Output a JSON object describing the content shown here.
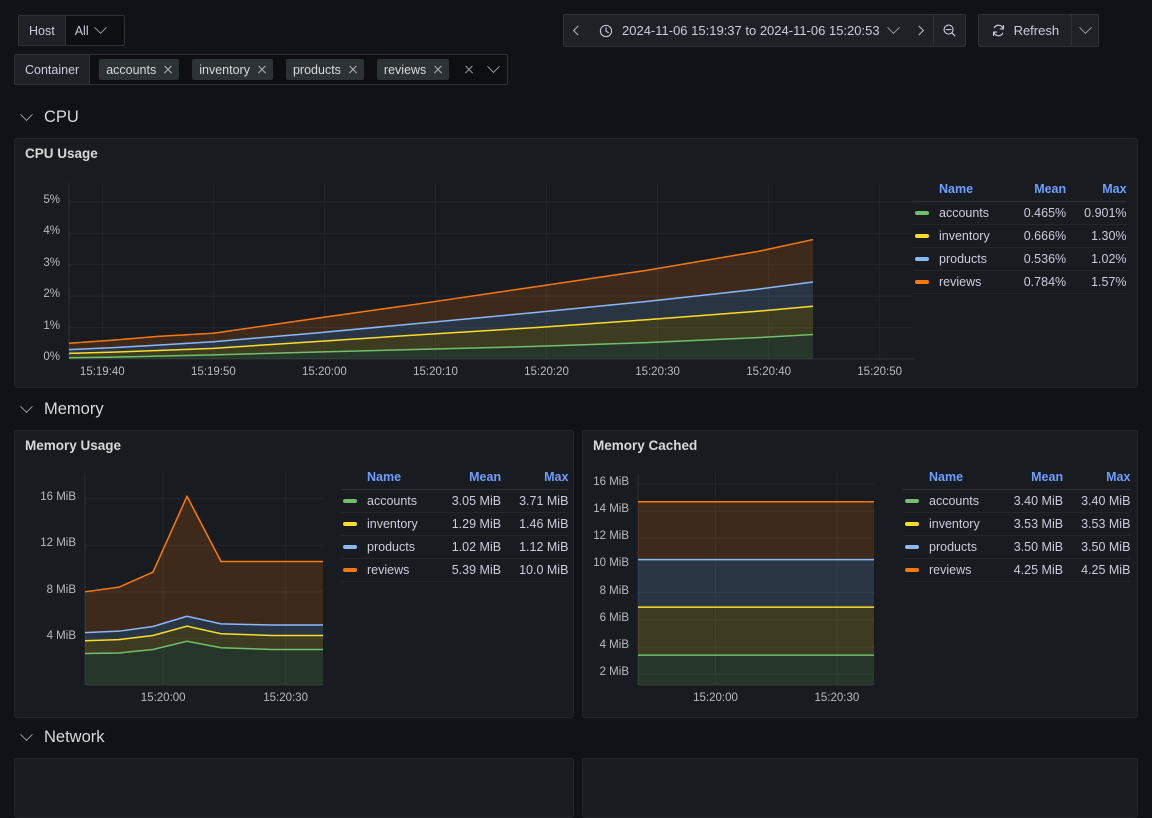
{
  "variables": {
    "host": {
      "label": "Host",
      "value": "All"
    },
    "container": {
      "label": "Container",
      "values": [
        "accounts",
        "inventory",
        "products",
        "reviews"
      ]
    }
  },
  "timepicker": {
    "range": "2024-11-06 15:19:37 to 2024-11-06 15:20:53",
    "prev_icon": "chevron-left-icon",
    "next_icon": "chevron-right-icon",
    "clock_icon": "clock-icon",
    "zoom_out_icon": "zoom-out-icon",
    "refresh_label": "Refresh",
    "refresh_icon": "refresh-icon"
  },
  "rows": [
    {
      "title": "CPU"
    },
    {
      "title": "Memory"
    },
    {
      "title": "Network"
    }
  ],
  "legend_headers": {
    "name": "Name",
    "mean": "Mean",
    "max": "Max"
  },
  "colors": {
    "accounts": "#73BF69",
    "inventory": "#FADE2A",
    "products": "#8AB8FF",
    "reviews": "#FF780A",
    "panel_bg": "#181b1f",
    "page_bg": "#111217",
    "accent": "#6e9fff"
  },
  "panels": {
    "cpu_usage": {
      "title": "CPU Usage",
      "legend": [
        {
          "name": "accounts",
          "mean": "0.465%",
          "max": "0.901%",
          "color": "#73BF69"
        },
        {
          "name": "inventory",
          "mean": "0.666%",
          "max": "1.30%",
          "color": "#FADE2A"
        },
        {
          "name": "products",
          "mean": "0.536%",
          "max": "1.02%",
          "color": "#8AB8FF"
        },
        {
          "name": "reviews",
          "mean": "0.784%",
          "max": "1.57%",
          "color": "#FF780A"
        }
      ]
    },
    "memory_usage": {
      "title": "Memory Usage",
      "legend": [
        {
          "name": "accounts",
          "mean": "3.05 MiB",
          "max": "3.71 MiB",
          "color": "#73BF69"
        },
        {
          "name": "inventory",
          "mean": "1.29 MiB",
          "max": "1.46 MiB",
          "color": "#FADE2A"
        },
        {
          "name": "products",
          "mean": "1.02 MiB",
          "max": "1.12 MiB",
          "color": "#8AB8FF"
        },
        {
          "name": "reviews",
          "mean": "5.39 MiB",
          "max": "10.0 MiB",
          "color": "#FF780A"
        }
      ]
    },
    "memory_cached": {
      "title": "Memory Cached",
      "legend": [
        {
          "name": "accounts",
          "mean": "3.40 MiB",
          "max": "3.40 MiB",
          "color": "#73BF69"
        },
        {
          "name": "inventory",
          "mean": "3.53 MiB",
          "max": "3.53 MiB",
          "color": "#FADE2A"
        },
        {
          "name": "products",
          "mean": "3.50 MiB",
          "max": "3.50 MiB",
          "color": "#8AB8FF"
        },
        {
          "name": "reviews",
          "mean": "4.25 MiB",
          "max": "4.25 MiB",
          "color": "#FF780A"
        }
      ]
    }
  },
  "chart_data": [
    {
      "id": "cpu_usage",
      "type": "area",
      "stacked": true,
      "title": "CPU Usage",
      "xlabel": "",
      "ylabel": "",
      "ylim": [
        0,
        5.6
      ],
      "yticks": [
        "0%",
        "1%",
        "2%",
        "3%",
        "4%",
        "5%"
      ],
      "ytick_values": [
        0,
        1,
        2,
        3,
        4,
        5
      ],
      "xticks": [
        "15:19:40",
        "15:19:50",
        "15:20:00",
        "15:20:10",
        "15:20:20",
        "15:20:30",
        "15:20:40",
        "15:20:50"
      ],
      "xlim_seconds": [
        15193700,
        15205300
      ],
      "grid": true,
      "legend_position": "right",
      "x": [
        0,
        4,
        8,
        13,
        22,
        32,
        42,
        52,
        62,
        67
      ],
      "series": [
        {
          "name": "accounts",
          "color": "#73BF69",
          "values": [
            0.04,
            0.06,
            0.09,
            0.13,
            0.22,
            0.31,
            0.4,
            0.52,
            0.68,
            0.78
          ]
        },
        {
          "name": "inventory",
          "color": "#FADE2A",
          "values": [
            0.18,
            0.22,
            0.27,
            0.34,
            0.55,
            0.78,
            1.0,
            1.25,
            1.52,
            1.68
          ]
        },
        {
          "name": "products",
          "color": "#8AB8FF",
          "values": [
            0.3,
            0.36,
            0.44,
            0.55,
            0.82,
            1.15,
            1.48,
            1.83,
            2.22,
            2.45
          ]
        },
        {
          "name": "reviews",
          "color": "#FF780A",
          "values": [
            0.5,
            0.6,
            0.72,
            0.82,
            1.28,
            1.78,
            2.3,
            2.82,
            3.42,
            3.8
          ]
        }
      ]
    },
    {
      "id": "memory_usage",
      "type": "area",
      "stacked": true,
      "title": "Memory Usage",
      "xlabel": "",
      "ylabel": "",
      "ylim": [
        0,
        18.2
      ],
      "yticks": [
        "4 MiB",
        "8 MiB",
        "12 MiB",
        "16 MiB"
      ],
      "ytick_values": [
        4,
        8,
        12,
        16
      ],
      "xticks": [
        "15:20:00",
        "15:20:30"
      ],
      "grid": true,
      "legend_position": "right",
      "x": [
        0,
        10,
        20,
        30,
        40,
        55,
        70
      ],
      "series": [
        {
          "name": "accounts",
          "color": "#73BF69",
          "values": [
            2.7,
            2.75,
            3.05,
            3.75,
            3.2,
            3.05,
            3.05
          ]
        },
        {
          "name": "inventory",
          "color": "#FADE2A",
          "values": [
            3.8,
            3.9,
            4.25,
            5.05,
            4.4,
            4.25,
            4.25
          ]
        },
        {
          "name": "products",
          "color": "#8AB8FF",
          "values": [
            4.5,
            4.62,
            5.02,
            5.9,
            5.25,
            5.15,
            5.15
          ]
        },
        {
          "name": "reviews",
          "color": "#FF780A",
          "values": [
            8.0,
            8.4,
            9.7,
            16.2,
            10.6,
            10.6,
            10.6
          ]
        }
      ]
    },
    {
      "id": "memory_cached",
      "type": "area",
      "stacked": true,
      "title": "Memory Cached",
      "xlabel": "",
      "ylabel": "",
      "ylim": [
        1.2,
        16.8
      ],
      "yticks": [
        "2 MiB",
        "4 MiB",
        "6 MiB",
        "8 MiB",
        "10 MiB",
        "12 MiB",
        "14 MiB",
        "16 MiB"
      ],
      "ytick_values": [
        2,
        4,
        6,
        8,
        10,
        12,
        14,
        16
      ],
      "xticks": [
        "15:20:00",
        "15:20:30"
      ],
      "grid": true,
      "legend_position": "right",
      "x": [
        0,
        70
      ],
      "series": [
        {
          "name": "accounts",
          "color": "#73BF69",
          "values": [
            3.4,
            3.4
          ]
        },
        {
          "name": "inventory",
          "color": "#FADE2A",
          "values": [
            6.93,
            6.93
          ]
        },
        {
          "name": "products",
          "color": "#8AB8FF",
          "values": [
            10.43,
            10.43
          ]
        },
        {
          "name": "reviews",
          "color": "#FF780A",
          "values": [
            14.68,
            14.68
          ]
        }
      ]
    }
  ]
}
